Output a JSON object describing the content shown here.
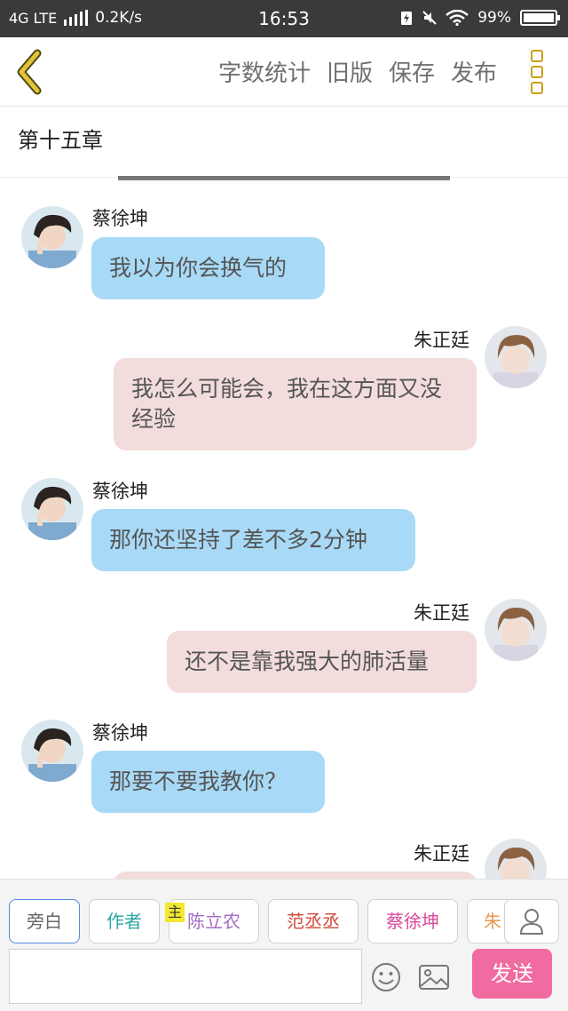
{
  "status_bar": {
    "network": "4G LTE",
    "speed": "0.2K/s",
    "time": "16:53",
    "battery": "99%"
  },
  "toolbar": {
    "word_count": "字数统计",
    "old_version": "旧版",
    "save": "保存",
    "publish": "发布"
  },
  "chapter": {
    "title": "第十五章"
  },
  "messages": [
    {
      "side": "left",
      "name": "蔡徐坤",
      "text": "我以为你会换气的"
    },
    {
      "side": "right",
      "name": "朱正廷",
      "text": "我怎么可能会，我在这方面又没经验"
    },
    {
      "side": "left",
      "name": "蔡徐坤",
      "text": "那你还坚持了差不多2分钟"
    },
    {
      "side": "right",
      "name": "朱正廷",
      "text": "还不是靠我强大的肺活量"
    },
    {
      "side": "left",
      "name": "蔡徐坤",
      "text": "那要不要我教你？"
    },
    {
      "side": "right",
      "name": "朱正廷",
      "text": ""
    }
  ],
  "roles": [
    {
      "label": "旁白",
      "color": "#666666"
    },
    {
      "label": "作者",
      "color": "#2aa8a0"
    },
    {
      "label": "陈立农",
      "color": "#a56cc4",
      "tag": "主"
    },
    {
      "label": "范丞丞",
      "color": "#d04a3a"
    },
    {
      "label": "蔡徐坤",
      "color": "#d8489a"
    },
    {
      "label": "朱",
      "color": "#e89a50"
    }
  ],
  "input": {
    "placeholder": ""
  },
  "send_label": "发送",
  "colors": {
    "left_bubble": "#a8daf7",
    "right_bubble": "#f2dcdc",
    "send_button": "#f06ba0",
    "accent": "#c8a21c"
  }
}
